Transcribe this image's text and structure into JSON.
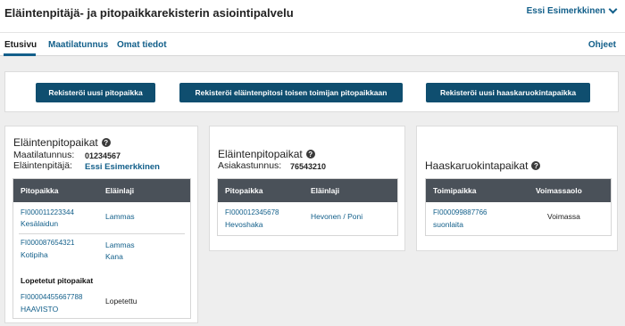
{
  "header": {
    "title": "Eläintenpitäjä- ja pitopaikkarekisterin asiointipalvelu",
    "user": "Essi Esimerkkinen"
  },
  "nav": {
    "tabs": [
      "Etusivu",
      "Maatilatunnus",
      "Omat tiedot"
    ],
    "help": "Ohjeet"
  },
  "actions": {
    "buttons": [
      "Rekisteröi uusi pitopaikka",
      "Rekisteröi eläintenpitosi toisen toimijan pitopaikkaan",
      "Rekisteröi uusi haaskaruokintapaikka"
    ]
  },
  "card1": {
    "title": "Eläintenpitopaikat",
    "farm_label": "Maatilatunnus:",
    "farm_value": "01234567",
    "keeper_label": "Eläintenpitäjä:",
    "keeper_value": "Essi Esimerkkinen",
    "columns": [
      "Pitopaikka",
      "Eläinlaji"
    ],
    "rows": [
      {
        "id": "FI000011223344",
        "name": "Kesälaidun",
        "species1": "Lammas",
        "species2": ""
      },
      {
        "id": "FI000087654321",
        "name": "Kotipiha",
        "species1": "Lammas",
        "species2": "Kana"
      }
    ],
    "ended_heading": "Lopetetut pitopaikat",
    "ended_row": {
      "id": "FI00004455667788",
      "name": "HAAVISTO",
      "status": "Lopetettu"
    }
  },
  "card2": {
    "title": "Eläintenpitopaikat",
    "customer_label": "Asiakastunnus:",
    "customer_value": "76543210",
    "columns": [
      "Pitopaikka",
      "Eläinlaji"
    ],
    "rows": [
      {
        "id": "FI000012345678",
        "name": "Hevoshaka",
        "species": "Hevonen / Poni"
      }
    ]
  },
  "card3": {
    "title": "Haaskaruokintapaikat",
    "columns": [
      "Toimipaikka",
      "Voimassaolo"
    ],
    "rows": [
      {
        "id": "FI000099887766",
        "name": "suonlaita",
        "validity": "Voimassa"
      }
    ]
  }
}
